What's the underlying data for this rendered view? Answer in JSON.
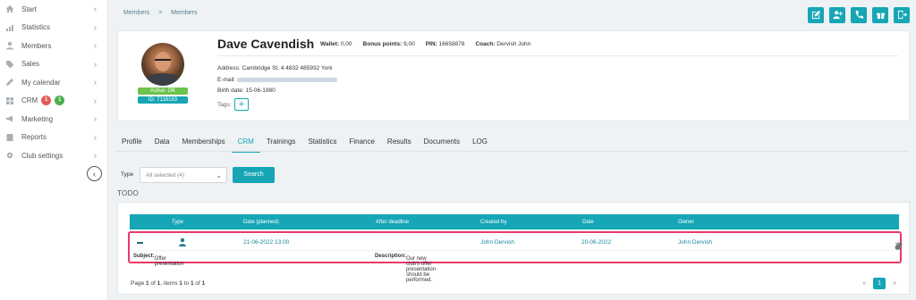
{
  "sidebar": {
    "items": [
      {
        "label": "Start",
        "icon": "home-icon"
      },
      {
        "label": "Statistics",
        "icon": "chart-icon"
      },
      {
        "label": "Members",
        "icon": "user-icon"
      },
      {
        "label": "Sales",
        "icon": "tag-icon"
      },
      {
        "label": "My calendar",
        "icon": "pen-icon"
      },
      {
        "label": "CRM",
        "icon": "grid-icon",
        "badge_red": "1",
        "badge_green": "1"
      },
      {
        "label": "Marketing",
        "icon": "megaphone-icon"
      },
      {
        "label": "Reports",
        "icon": "book-icon"
      },
      {
        "label": "Club settings",
        "icon": "gear-icon"
      }
    ],
    "collapse_glyph": "‹"
  },
  "breadcrumb": {
    "first": "Members",
    "separator": ">",
    "second": "Members"
  },
  "top_actions": [
    "edit-icon",
    "add-user-icon",
    "phone-icon",
    "gift-icon",
    "logout-icon"
  ],
  "profile": {
    "name": "Dave Cavendish",
    "wallet_label": "Wallet:",
    "wallet_value": "0,00",
    "bonus_label": "Bonus points:",
    "bonus_value": "9,00",
    "pin_label": "PIN:",
    "pin_value": "16658878",
    "coach_label": "Coach:",
    "coach_value": "Dervish John",
    "address_label": "Address:",
    "address_value": "Cambridge St, 4 4832 485932 York",
    "email_label": "E-mail:",
    "birth_label": "Birth date:",
    "birth_value": "15-06-1980",
    "tags_label": "Tags:",
    "tags_add": "+",
    "status_text": "Active: OK",
    "id_text": "ID: 7118183"
  },
  "tabs": [
    {
      "label": "Profile",
      "active": false
    },
    {
      "label": "Data",
      "active": false
    },
    {
      "label": "Memberships",
      "active": false
    },
    {
      "label": "CRM",
      "active": true
    },
    {
      "label": "Trainings",
      "active": false
    },
    {
      "label": "Statistics",
      "active": false
    },
    {
      "label": "Finance",
      "active": false
    },
    {
      "label": "Results",
      "active": false
    },
    {
      "label": "Documents",
      "active": false
    },
    {
      "label": "LOG",
      "active": false
    }
  ],
  "filter": {
    "type_label": "Type",
    "type_value": "All selected (4)",
    "search_label": "Search"
  },
  "section_title": "TODO",
  "table": {
    "headers": [
      "Type",
      "Date (planned)",
      "After deadline",
      "Created by",
      "Date",
      "Owner"
    ],
    "row": {
      "date_planned": "21-06-2022 13:00",
      "created_by": "John Dervish",
      "date": "20-06-2022",
      "owner": "John Dervish"
    },
    "subject_label": "Subject:",
    "subject_value": "Offer presentation",
    "description_label": "Description:",
    "description_value": "Our new club's offer presentation should be performed."
  },
  "pager": {
    "prefix": "Page",
    "page": "1",
    "of": "of",
    "pages": "1",
    "items_label": ", items",
    "from": "1",
    "to": "to",
    "to_val": "1",
    "of2": "of",
    "total": "1",
    "prev": "«",
    "current": "1",
    "next": "»"
  },
  "colors": {
    "accent": "#16a6b6",
    "highlight": "#e8386a",
    "badge_red": "#e35b5b",
    "badge_green": "#4caf50"
  }
}
